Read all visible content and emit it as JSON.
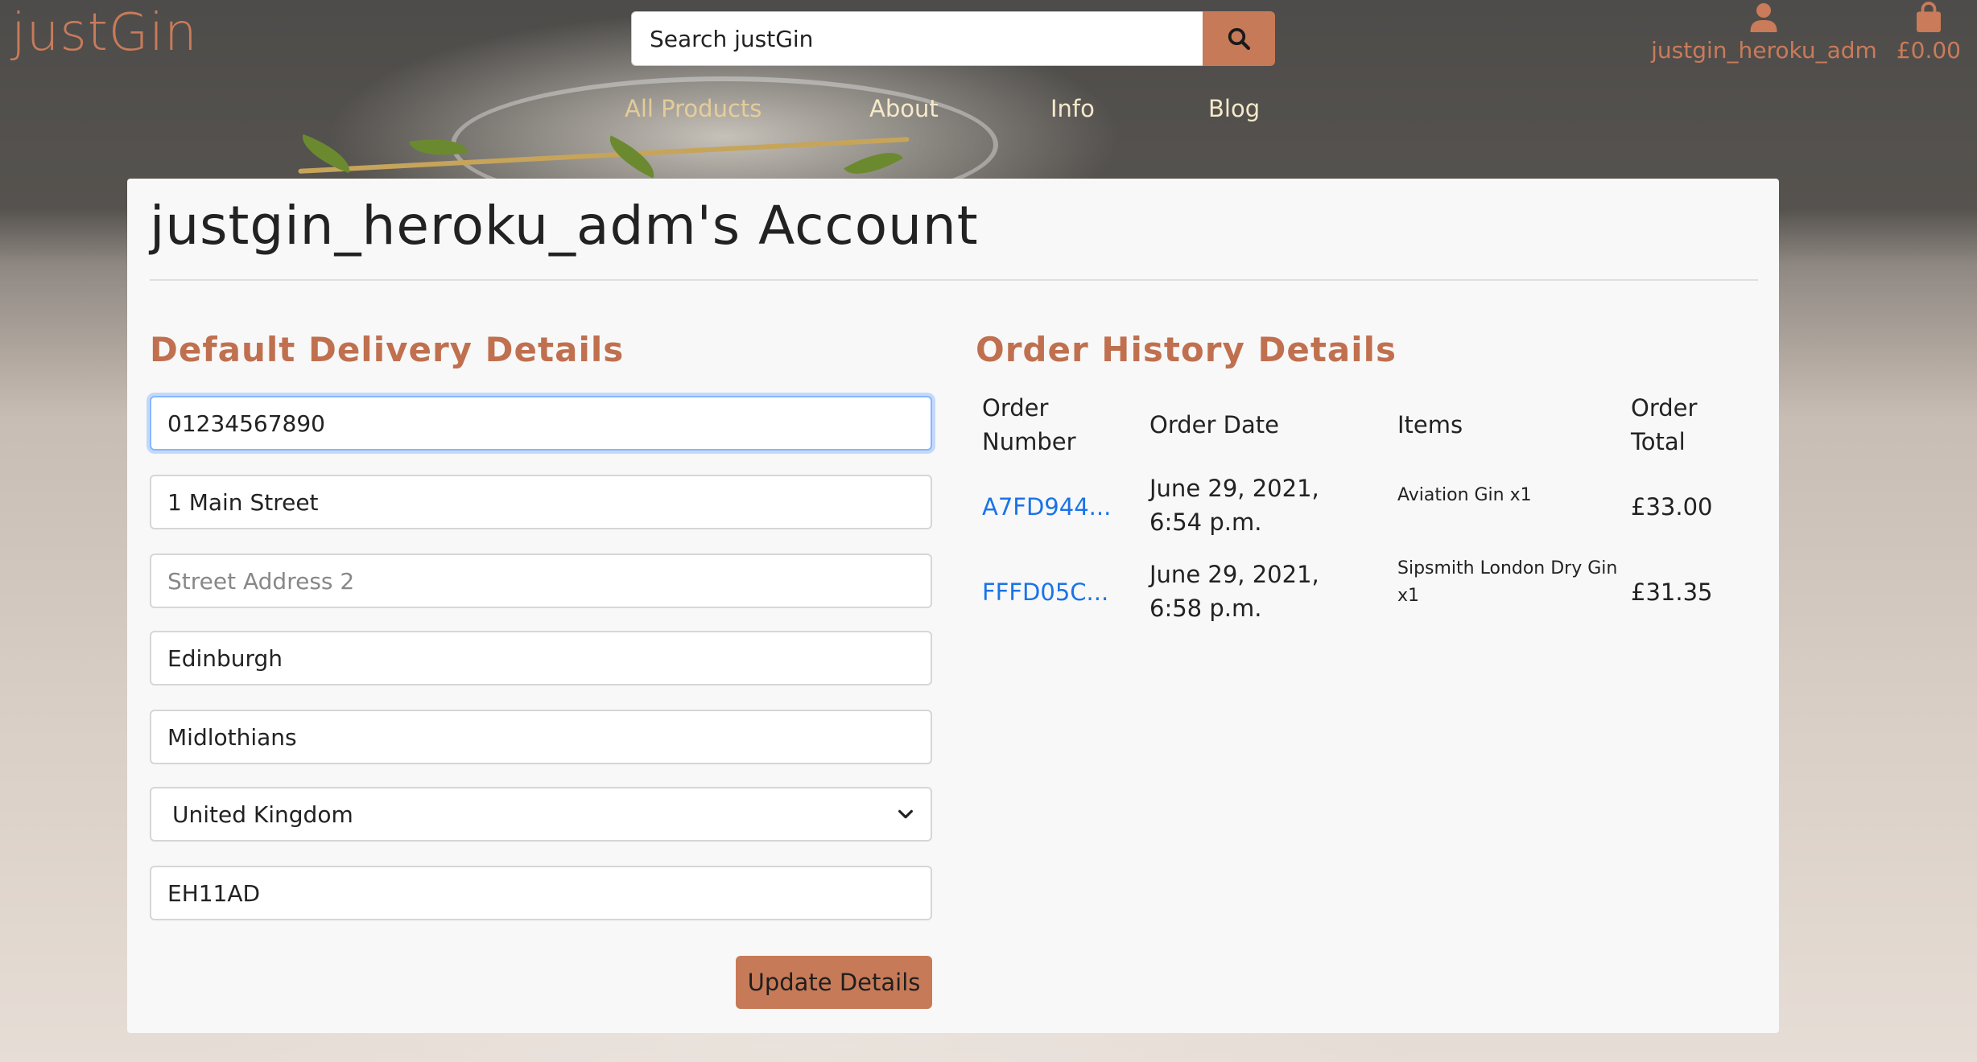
{
  "brand": {
    "logo": "justGin"
  },
  "search": {
    "placeholder": "Search justGin"
  },
  "account": {
    "username": "justgin_heroku_adm",
    "basket_total": "£0.00"
  },
  "nav": {
    "items": [
      "All Products",
      "About",
      "Info",
      "Blog"
    ]
  },
  "page": {
    "title": "justgin_heroku_adm's Account"
  },
  "delivery": {
    "title": "Default Delivery Details",
    "phone": "01234567890",
    "street1": "1 Main Street",
    "street2_placeholder": "Street Address 2",
    "town": "Edinburgh",
    "county": "Midlothians",
    "country": "United Kingdom",
    "postcode": "EH11AD",
    "button": "Update Details"
  },
  "orders": {
    "title": "Order History Details",
    "headers": [
      "Order Number",
      "Order Date",
      "Items",
      "Order Total"
    ],
    "rows": [
      {
        "number": "A7FD944...",
        "date": "June 29, 2021, 6:54 p.m.",
        "items": "Aviation Gin x1",
        "total": "£33.00"
      },
      {
        "number": "FFFD05C...",
        "date": "June 29, 2021, 6:58 p.m.",
        "items": "Sipsmith London Dry Gin x1",
        "total": "£31.35"
      }
    ]
  },
  "colors": {
    "accent": "#c77a57",
    "link": "#1a73e8",
    "card": "#f8f8f8"
  }
}
